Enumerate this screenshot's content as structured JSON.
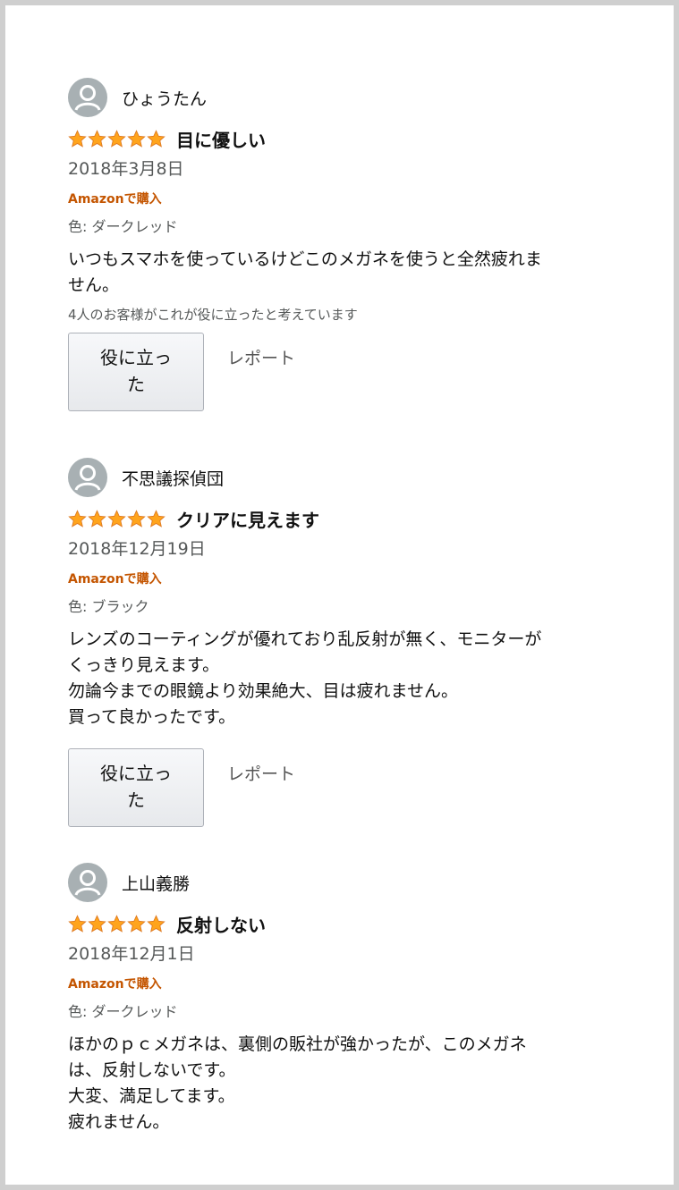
{
  "reviews": [
    {
      "profile_name": "ひょうたん",
      "rating": 5,
      "title": "目に優しい",
      "date": "2018年3月8日",
      "verified": "Amazonで購入",
      "variant": "色: ダークレッド",
      "body": "いつもスマホを使っているけどこのメガネを使うと全然疲れま\nせん。",
      "helpful_count": "4人のお客様がこれが役に立ったと考えています",
      "helpful_button": "役に立った",
      "report": "レポート"
    },
    {
      "profile_name": "不思議探偵団",
      "rating": 5,
      "title": "クリアに見えます",
      "date": "2018年12月19日",
      "verified": "Amazonで購入",
      "variant": "色: ブラック",
      "body": "レンズのコーティングが優れており乱反射が無く、モニターが\nくっきり見えます。\n勿論今までの眼鏡より効果絶大、目は疲れません。\n買って良かったです。",
      "helpful_button": "役に立った",
      "report": "レポート"
    },
    {
      "profile_name": "上山義勝",
      "rating": 5,
      "title": "反射しない",
      "date": "2018年12月1日",
      "verified": "Amazonで購入",
      "variant": "色: ダークレッド",
      "body": "ほかのｐｃメガネは、裏側の販社が強かったが、このメガネ\nは、反射しないです。\n大変、満足してます。\n疲れません。"
    }
  ],
  "colors": {
    "star": "#ffa41c",
    "star_stroke": "#de7921",
    "verified": "#c45500",
    "avatar": "#a8b0b3"
  },
  "icons": {
    "avatar": "default-profile-icon",
    "star": "star-icon"
  }
}
